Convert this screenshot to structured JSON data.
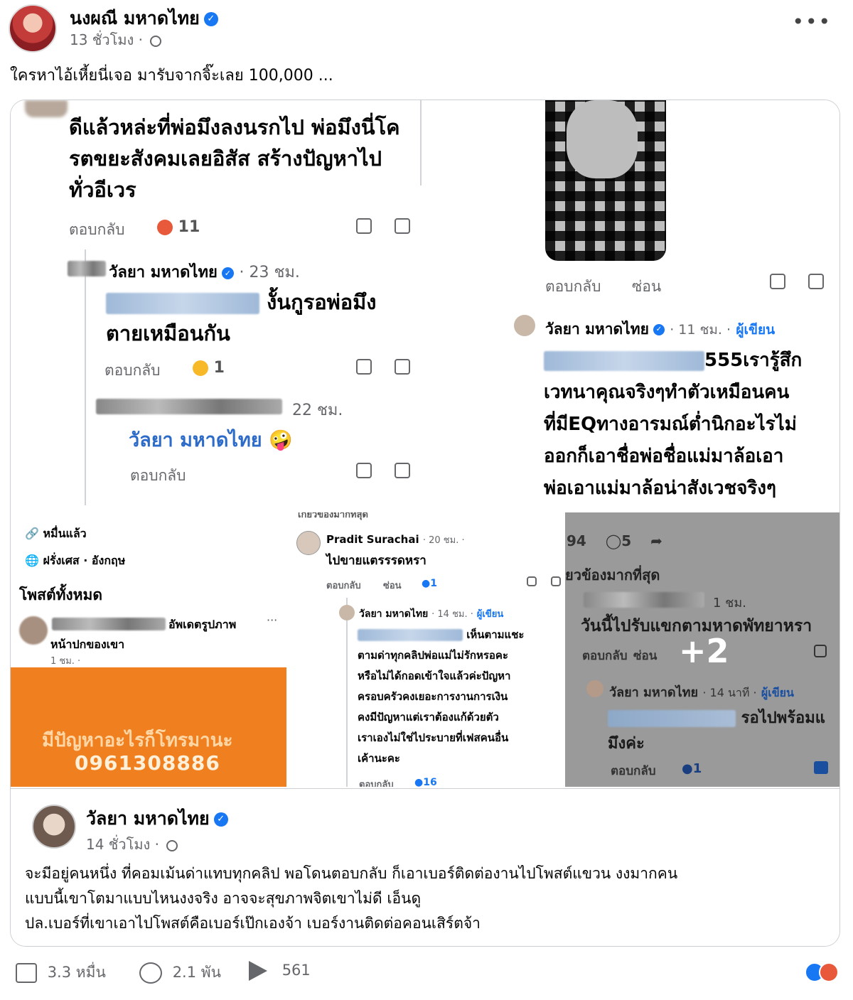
{
  "post": {
    "author": "นงผณี มหาดไทย",
    "time": "13 ชั่วโมง ·",
    "caption": "ใครหาไอ้เหี้ยนี่เจอ มารับจากจิ๊ะเลย 100,000 ..."
  },
  "panel1": {
    "comment_text": [
      "ดีแล้วหล่ะที่พ่อมึงลงนรกไป พ่อมึงนี่โค",
      "รตขยะสังคมเลยอิสัส สร้างปัญหาไป",
      "ทั่วอีเวร"
    ],
    "reply_label": "ตอบกลับ",
    "reaction_count": "11",
    "reply1_author": "วัลยา มหาดไทย",
    "reply1_time": "· 23 ชม.",
    "reply1_text_a": "งั้นกูรอพ่อมึง",
    "reply1_text_b": "ตายเหมือนกัน",
    "reply1_count": "1",
    "reply2_time": "22 ชม.",
    "reply2_text": "วัลยา มหาดไทย 🤪"
  },
  "panel2": {
    "reply_label": "ตอบกลับ",
    "hide_label": "ซ่อน",
    "author": "วัลยา มหาดไทย",
    "time": "· 11 ชม. ·",
    "author_badge": "ผู้เขียน",
    "text": [
      "555เรารู้สึก",
      "เวทนาคุณจริงๆทำตัวเหมือนคน",
      "ที่มีEQทางอารมณ์ต่ำนิกอะไรไม่",
      "ออกก็เอาชื่อพ่อชื่อแม่มาล้อเอา",
      "พ่อเอาแม่มาล้อน่าสังเวชจริงๆ"
    ]
  },
  "panel3": {
    "followers": "หมื่นแล้ว",
    "language": "ฝรั่งเศส · อังกฤษ",
    "all_posts": "โพสต์ทั้งหมด",
    "update_text": "อัพเดตรูปภาพ",
    "update_sub": "หน้าปกของเขา",
    "update_time": "1 ชม. ·",
    "banner_line1": "มีปัญหาอะไรก็โทรมานะ",
    "banner_phone": "0961308886"
  },
  "panel4": {
    "top_label": "เกี่ยวข้องมากที่สุด",
    "c1_author": "Pradit Surachai",
    "c1_time": "· 20 ชม. ·",
    "c1_text": "ไปขายแตรรรดหรา",
    "reply_label": "ตอบกลับ",
    "hide_label": "ซ่อน",
    "c1_count": "1",
    "c2_author": "วัลยา มหาดไทย",
    "c2_time": "· 14 ชม. ·",
    "c2_badge": "ผู้เขียน",
    "c2_text": [
      "เห็นตามแชะ",
      "ตามด่าทุกคลิปพ่อแม่ไม่รักหรอคะ",
      "หรือไม่ได้กอดเข้าใจแล้วค่ะปัญหา",
      "ครอบครัวคงเยอะการงานการเงิน",
      "คงมีปัญหาแต่เราต้องแก้ด้วยตัว",
      "เราเองไม่ใช่ไประบายที่เฟสคนอื่น",
      "เค้านะคะ"
    ],
    "c2_count": "16"
  },
  "panel5": {
    "stats_left": "94",
    "stats_comments": "5",
    "top_label": "ยวข้องมากที่สุด",
    "c1_time": "1 ชม.",
    "c1_text": "วันนี้ไปรับแขกตามหาดพัทยาหรา",
    "reply_label": "ตอบกลับ",
    "hide_label": "ซ่อน",
    "more_count": "+2",
    "c2_author": "วัลยา มหาดไทย",
    "c2_time": "· 14 นาที ·",
    "c2_badge": "ผู้เขียน",
    "c2_text_a": "รอไปพร้อมแ",
    "c2_text_b": "มึงค่ะ",
    "c2_count": "1"
  },
  "shared": {
    "author": "วัลยา มหาดไทย",
    "time": "14 ชั่วโมง ·",
    "text": [
      "จะมีอยู่คนหนึ่ง ที่คอมเม้นด่าแทบทุกคลิป พอโดนตอบกลับ ก็เอาเบอร์ติดต่องานไปโพสต์แขวน  งงมากคน",
      "แบบนี้เขาโตมาแบบไหนงงจริง อาจจะสุขภาพจิตเขาไม่ดี เอ็นดู",
      "ปล.เบอร์ที่เขาเอาไปโพสต์คือเบอร์เป๊กเองจ้า เบอร์งานติดต่อคอนเสิร์ตจ้า"
    ]
  },
  "footer": {
    "likes": "3.3 หมื่น",
    "comments": "2.1 พัน",
    "shares": "561"
  },
  "colors": {
    "verified": "#1877f2",
    "orange_banner": "#f07f1f"
  },
  "icons": [
    "more-icon",
    "globe-icon",
    "verified-icon",
    "like-icon",
    "dislike-icon",
    "comment-icon",
    "share-icon",
    "angry-reaction-icon",
    "haha-reaction-icon"
  ]
}
